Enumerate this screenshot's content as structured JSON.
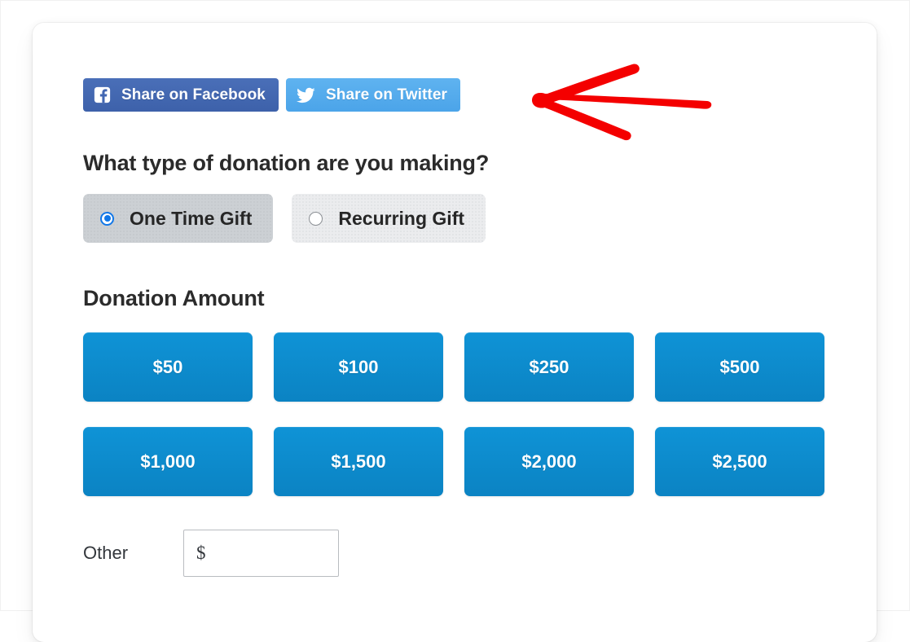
{
  "card": {
    "share": {
      "facebook": {
        "label": "Share on Facebook",
        "icon": "facebook-icon",
        "color": "#4267b2"
      },
      "twitter": {
        "label": "Share on Twitter",
        "icon": "twitter-icon",
        "color": "#55acee"
      }
    },
    "donation_type": {
      "heading": "What type of donation are you making?",
      "options": [
        {
          "label": "One Time Gift",
          "selected": true
        },
        {
          "label": "Recurring Gift",
          "selected": false
        }
      ]
    },
    "donation_amount": {
      "heading": "Donation Amount",
      "button_color": "#0d8ccd",
      "amounts": [
        "$50",
        "$100",
        "$250",
        "$500",
        "$1,000",
        "$1,500",
        "$2,000",
        "$2,500"
      ],
      "other": {
        "label": "Other",
        "value": "$",
        "placeholder": ""
      }
    }
  },
  "annotation": {
    "arrow": {
      "name": "red-arrow-pointing-left",
      "color": "#f40000",
      "direction": "left"
    }
  }
}
